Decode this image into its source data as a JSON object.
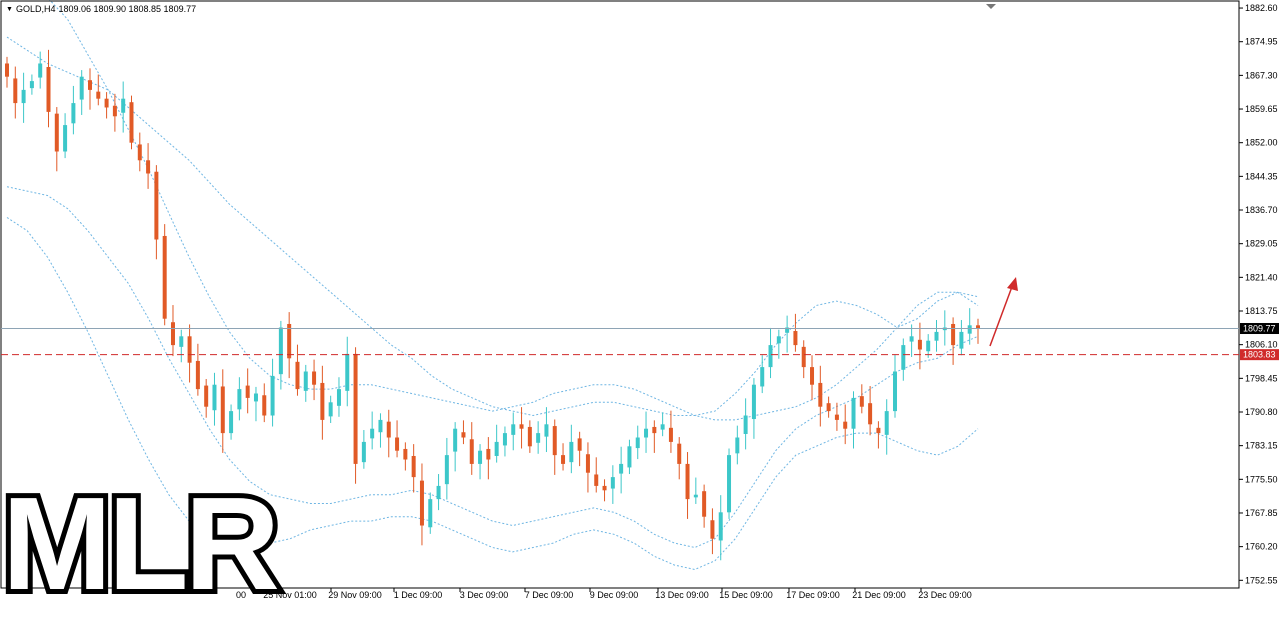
{
  "header": {
    "symbol": "GOLD,H4",
    "ohlc": "1809.06 1809.90 1808.85 1809.77"
  },
  "watermark": {
    "text": "MLR"
  },
  "colors": {
    "bull": "#3cc7c9",
    "bear": "#e15a26",
    "band": "#6fb6e3",
    "current_line": "#8ea4b5",
    "support_line": "#d02a2a",
    "arrow": "#d02a2a",
    "label_current_bg": "#000000",
    "label_support_bg": "#d02a2a"
  },
  "chart_data": {
    "type": "candlestick",
    "title": "",
    "y_axis": {
      "ticks": [
        "1882.60",
        "1874.95",
        "1867.30",
        "1859.65",
        "1852.00",
        "1844.35",
        "1836.70",
        "1829.05",
        "1821.40",
        "1813.75",
        "1806.10",
        "1798.45",
        "1790.80",
        "1783.15",
        "1775.50",
        "1767.85",
        "1760.20",
        "1752.55"
      ],
      "range": [
        1750.8,
        1884.2
      ]
    },
    "x_axis": {
      "tick_labels": [
        "25 Nov 01:00",
        "29 Nov 09:00",
        "1 Dec 09:00",
        "3 Dec 09:00",
        "7 Dec 09:00",
        "9 Dec 09:00",
        "13 Dec 09:00",
        "15 Dec 09:00",
        "17 Dec 09:00",
        "21 Dec 09:00",
        "23 Dec 09:00"
      ],
      "partially_hidden_label": "00"
    },
    "current_price": {
      "value": 1809.77,
      "label": "1809.77"
    },
    "support_level": {
      "value": 1803.83,
      "label": "1803.83"
    },
    "closes": [
      1867,
      1861,
      1864,
      1866,
      1870,
      1859,
      1850,
      1856,
      1861,
      1867,
      1864,
      1862,
      1860,
      1858,
      1862,
      1852,
      1848,
      1845,
      1830,
      1812,
      1806,
      1808,
      1802,
      1796,
      1792,
      1797,
      1786,
      1791,
      1796,
      1794,
      1795,
      1790,
      1799,
      1810,
      1803,
      1796,
      1800,
      1797,
      1789,
      1793,
      1796,
      1804,
      1779,
      1784,
      1787,
      1789,
      1785,
      1782,
      1780,
      1776,
      1765,
      1771,
      1774,
      1781,
      1787,
      1785,
      1779,
      1782,
      1780,
      1784,
      1786,
      1788,
      1787,
      1783,
      1786,
      1788,
      1781,
      1779,
      1784,
      1782,
      1777,
      1774,
      1773,
      1776,
      1779,
      1783,
      1785,
      1787,
      1786,
      1788,
      1784,
      1779,
      1771,
      1772,
      1767,
      1762,
      1768,
      1781,
      1785,
      1790,
      1797,
      1801,
      1806,
      1808,
      1810,
      1806,
      1801,
      1797,
      1792,
      1791,
      1789,
      1787,
      1794,
      1792,
      1788,
      1786,
      1791,
      1800,
      1806,
      1808,
      1805,
      1807,
      1809,
      1810,
      1806,
      1809,
      1810.5,
      1809.77
    ],
    "bands": {
      "upper": [
        1876,
        1873,
        1870,
        1868,
        1866,
        1864,
        1860,
        1856,
        1852,
        1848,
        1843,
        1838,
        1834,
        1830,
        1826,
        1822,
        1818,
        1814,
        1810,
        1806,
        1803,
        1799,
        1796,
        1794,
        1792,
        1791,
        1790,
        1791,
        1792,
        1793,
        1793,
        1792,
        1791,
        1790,
        1790,
        1789,
        1789,
        1790,
        1791,
        1792,
        1794,
        1797,
        1801,
        1805,
        1810,
        1815,
        1818,
        1818,
        1815
      ],
      "lower": [
        1842,
        1841,
        1840,
        1837,
        1832,
        1826,
        1820,
        1812,
        1803,
        1795,
        1787,
        1780,
        1775,
        1772,
        1771,
        1770,
        1770,
        1771,
        1772,
        1772,
        1773,
        1772,
        1770,
        1768,
        1766,
        1765,
        1766,
        1767,
        1768,
        1769,
        1768,
        1766,
        1763,
        1761,
        1760,
        1762,
        1768,
        1775,
        1782,
        1787,
        1790,
        1792,
        1794,
        1797,
        1800,
        1802,
        1803,
        1806,
        1808
      ],
      "outer_upper": [
        1890,
        1888,
        1885,
        1880,
        1872,
        1864,
        1855,
        1846,
        1836,
        1826,
        1817,
        1809,
        1803,
        1799,
        1797,
        1796,
        1796,
        1797,
        1797,
        1796,
        1795,
        1794,
        1793,
        1792,
        1791,
        1792,
        1793,
        1795,
        1796,
        1797,
        1797,
        1796,
        1794,
        1792,
        1790,
        1791,
        1795,
        1800,
        1806,
        1811,
        1815,
        1816,
        1815,
        1813,
        1810,
        1812,
        1816,
        1818,
        1817
      ],
      "outer_lower": [
        1835,
        1832,
        1826,
        1818,
        1809,
        1799,
        1789,
        1780,
        1772,
        1766,
        1762,
        1760,
        1760,
        1761,
        1762,
        1764,
        1765,
        1766,
        1766,
        1767,
        1767,
        1766,
        1764,
        1762,
        1760,
        1759,
        1760,
        1761,
        1763,
        1764,
        1763,
        1761,
        1758,
        1756,
        1755,
        1757,
        1762,
        1769,
        1776,
        1781,
        1783,
        1785,
        1786,
        1786,
        1784,
        1782,
        1781,
        1783,
        1787
      ]
    }
  }
}
